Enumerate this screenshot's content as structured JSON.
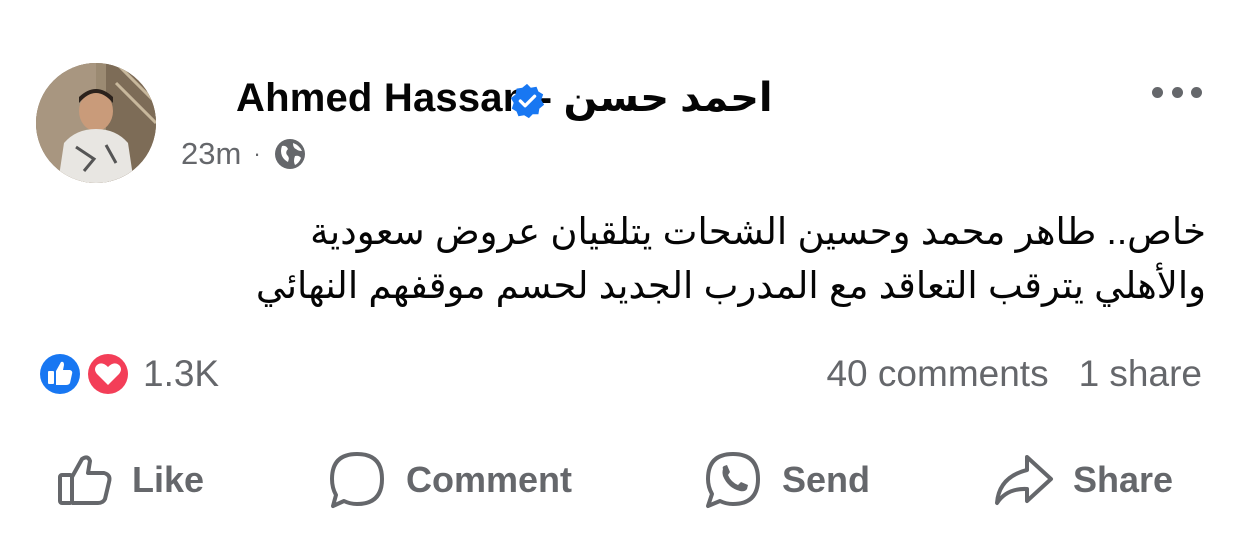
{
  "post": {
    "author_name": "Ahmed Hassan - احمد حسن",
    "time": "23m",
    "separator": "·",
    "audience_icon": "globe-icon",
    "text_line_1": "خاص.. طاهر محمد وحسين الشحات يتلقيان عروض سعودية",
    "text_line_2": "والأهلي يترقب التعاقد مع المدرب الجديد لحسم موقفهم النهائي"
  },
  "reactions": {
    "icons": [
      "like-reaction-icon",
      "love-reaction-icon"
    ],
    "count": "1.3K",
    "comments": "40 comments",
    "shares": "1 share"
  },
  "actions": {
    "like": "Like",
    "comment": "Comment",
    "send": "Send",
    "share": "Share"
  },
  "colors": {
    "verified": "#1877f2",
    "secondary_text": "#65676b",
    "like_blue": "#1877f2",
    "love_red": "#f33e58"
  }
}
